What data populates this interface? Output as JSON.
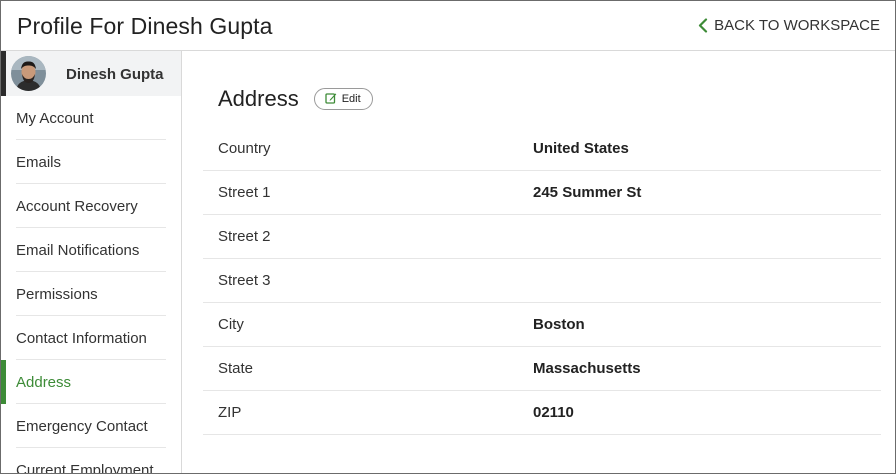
{
  "header": {
    "title": "Profile For Dinesh Gupta",
    "back_label": "BACK TO WORKSPACE"
  },
  "sidebar": {
    "profile_name": "Dinesh Gupta",
    "items": [
      {
        "label": "My Account"
      },
      {
        "label": "Emails"
      },
      {
        "label": "Account Recovery"
      },
      {
        "label": "Email Notifications"
      },
      {
        "label": "Permissions"
      },
      {
        "label": "Contact Information"
      },
      {
        "label": "Address"
      },
      {
        "label": "Emergency Contact"
      },
      {
        "label": "Current Employment"
      }
    ],
    "active_item": "Address"
  },
  "main": {
    "section_title": "Address",
    "edit_label": "Edit",
    "fields": [
      {
        "label": "Country",
        "value": "United States"
      },
      {
        "label": "Street 1",
        "value": "245 Summer St"
      },
      {
        "label": "Street 2",
        "value": ""
      },
      {
        "label": "Street 3",
        "value": ""
      },
      {
        "label": "City",
        "value": "Boston"
      },
      {
        "label": "State",
        "value": "Massachusetts"
      },
      {
        "label": "ZIP",
        "value": "02110"
      }
    ]
  },
  "icons": {
    "back": "chevron-left-icon",
    "edit": "edit-icon"
  },
  "colors": {
    "accent": "#3d8b37",
    "profile_row_bg": "#f2f3f4",
    "divider": "#e6e6e6"
  }
}
